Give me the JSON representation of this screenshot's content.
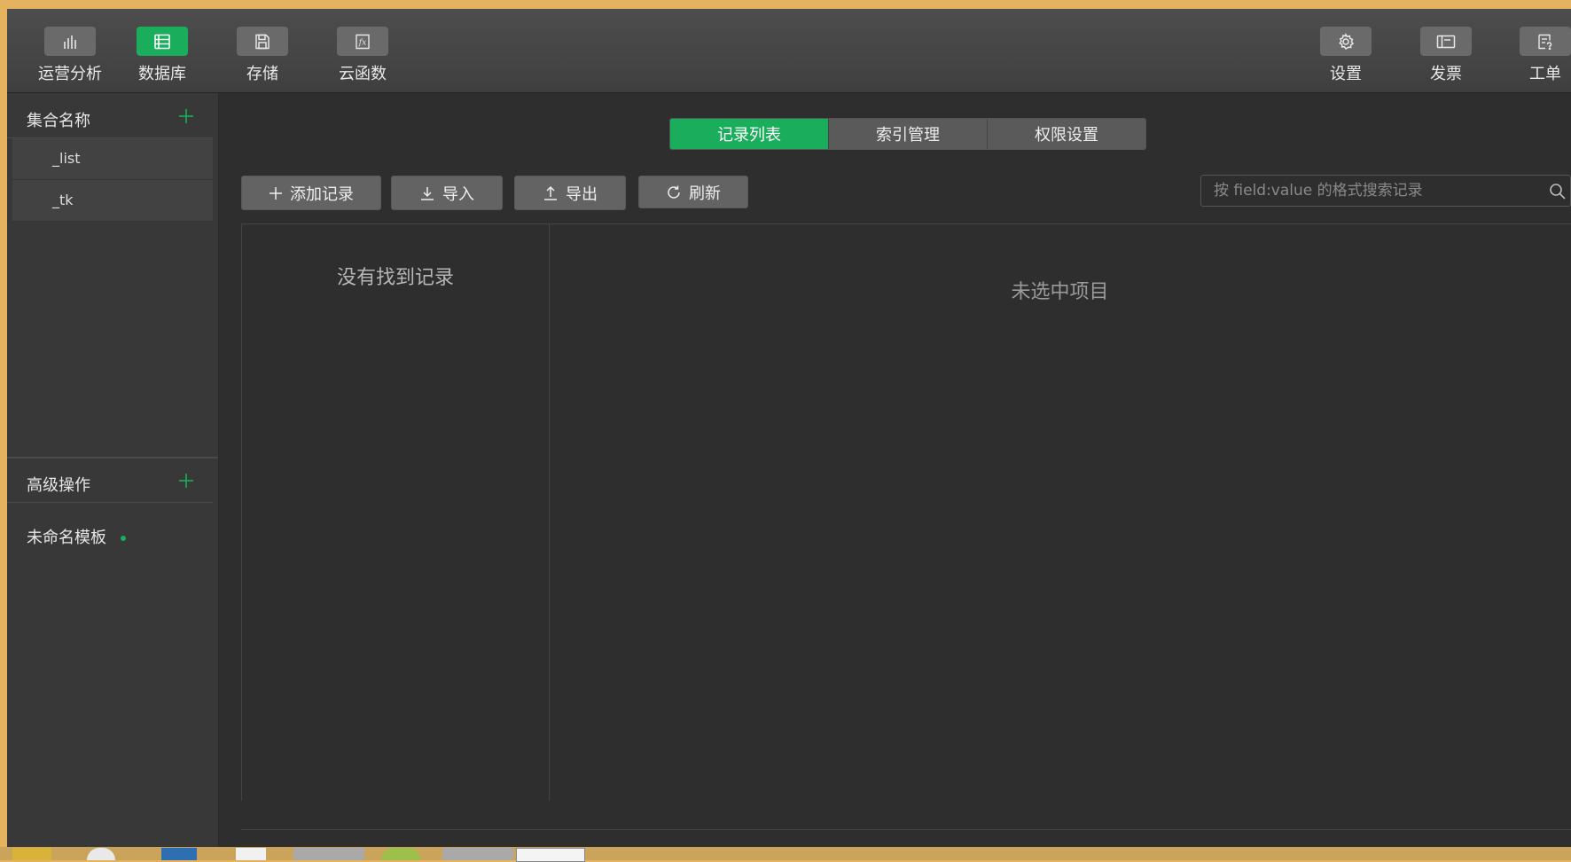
{
  "toolbar": {
    "left": [
      {
        "label": "运营分析",
        "icon": "bar-chart-icon"
      },
      {
        "label": "数据库",
        "icon": "database-icon",
        "active": true
      },
      {
        "label": "存储",
        "icon": "save-icon"
      },
      {
        "label": "云函数",
        "icon": "function-icon"
      }
    ],
    "right": [
      {
        "label": "设置",
        "icon": "gear-icon"
      },
      {
        "label": "发票",
        "icon": "invoice-icon"
      },
      {
        "label": "工单",
        "icon": "ticket-icon"
      }
    ]
  },
  "sidebar": {
    "collections_title": "集合名称",
    "collections": [
      {
        "name": "_list"
      },
      {
        "name": "_tk"
      }
    ],
    "advanced_title": "高级操作",
    "template_name": "未命名模板"
  },
  "tabs": [
    {
      "label": "记录列表",
      "active": true
    },
    {
      "label": "索引管理"
    },
    {
      "label": "权限设置"
    }
  ],
  "actions": {
    "add": "添加记录",
    "import": "导入",
    "export": "导出",
    "refresh": "刷新"
  },
  "search": {
    "placeholder": "按 field:value 的格式搜索记录"
  },
  "list_empty": "没有找到记录",
  "detail_empty": "未选中项目",
  "colors": {
    "accent": "#1aad5b",
    "background": "#2e2e2e",
    "toolbar": "#474747"
  }
}
